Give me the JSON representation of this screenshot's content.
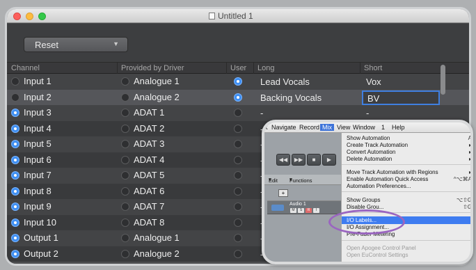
{
  "window": {
    "title": "Untitled 1"
  },
  "toolbar": {
    "reset_label": "Reset"
  },
  "table": {
    "headers": [
      "Channel",
      "Provided by Driver",
      "User",
      "Long",
      "Short"
    ],
    "rows": [
      {
        "channel": "Input 1",
        "channel_on": false,
        "driver": "Analogue 1",
        "user_on": true,
        "long": "Lead Vocals",
        "short": "Vox"
      },
      {
        "channel": "Input 2",
        "channel_on": false,
        "driver": "Analogue 2",
        "user_on": true,
        "long": "Backing Vocals",
        "short": "BV"
      },
      {
        "channel": "Input 3",
        "channel_on": true,
        "driver": "ADAT 1",
        "user_on": false,
        "long": "-",
        "short": "-"
      },
      {
        "channel": "Input 4",
        "channel_on": true,
        "driver": "ADAT 2",
        "user_on": false,
        "long": "-",
        "short": ""
      },
      {
        "channel": "Input 5",
        "channel_on": true,
        "driver": "ADAT 3",
        "user_on": false,
        "long": "-",
        "short": ""
      },
      {
        "channel": "Input 6",
        "channel_on": true,
        "driver": "ADAT 4",
        "user_on": false,
        "long": "-",
        "short": ""
      },
      {
        "channel": "Input 7",
        "channel_on": true,
        "driver": "ADAT 5",
        "user_on": false,
        "long": "-",
        "short": ""
      },
      {
        "channel": "Input 8",
        "channel_on": true,
        "driver": "ADAT 6",
        "user_on": false,
        "long": "-",
        "short": ""
      },
      {
        "channel": "Input 9",
        "channel_on": true,
        "driver": "ADAT 7",
        "user_on": false,
        "long": "-",
        "short": ""
      },
      {
        "channel": "Input 10",
        "channel_on": true,
        "driver": "ADAT 8",
        "user_on": false,
        "long": "-",
        "short": ""
      },
      {
        "channel": "Output 1",
        "channel_on": true,
        "driver": "Analogue 1",
        "user_on": false,
        "long": "-",
        "short": ""
      },
      {
        "channel": "Output 2",
        "channel_on": true,
        "driver": "Analogue 2",
        "user_on": false,
        "long": "-",
        "short": ""
      }
    ]
  },
  "inset": {
    "menubar": [
      "k",
      "Navigate",
      "Record",
      "Mix",
      "View",
      "Window",
      "1",
      "Help"
    ],
    "active_menu": "Mix",
    "transport_icons": [
      "rewind-icon",
      "fast-forward-icon",
      "stop-icon",
      "play-icon"
    ],
    "transport_glyphs": [
      "◀◀",
      "▶▶",
      "■",
      "▶"
    ],
    "edit_toolbar": [
      "Edit",
      "Functions"
    ],
    "plus_label": "+",
    "track_name": "Audio 1",
    "track_buttons": [
      "M",
      "S",
      "R",
      "I"
    ],
    "menu_items": [
      {
        "label": "Show Automation",
        "shortcut": "A",
        "state": "normal"
      },
      {
        "label": "Create Track Automation",
        "shortcut": "▸",
        "state": "normal"
      },
      {
        "label": "Convert Automation",
        "shortcut": "▸",
        "state": "normal"
      },
      {
        "label": "Delete Automation",
        "shortcut": "▸",
        "state": "normal"
      },
      {
        "label": "Move Track Automation with Regions",
        "shortcut": "▸",
        "state": "normal"
      },
      {
        "label": "Enable Automation Quick Access",
        "shortcut": "^⌥⌘A",
        "state": "normal"
      },
      {
        "label": "Automation Preferences...",
        "shortcut": "",
        "state": "normal"
      },
      {
        "label": "Show Groups",
        "shortcut": "⌥⇧G",
        "state": "normal"
      },
      {
        "label": "Disable Grou...",
        "shortcut": "⇧G",
        "state": "normal"
      },
      {
        "label": "I/O Labels...",
        "shortcut": "",
        "state": "highlighted"
      },
      {
        "label": "I/O Assignment...",
        "shortcut": "",
        "state": "normal"
      },
      {
        "label": "Pre-Fader Metering",
        "shortcut": "",
        "state": "normal"
      },
      {
        "label": "Open Apogee Control Panel",
        "shortcut": "",
        "state": "disabled"
      },
      {
        "label": "Open EuControl Settings",
        "shortcut": "",
        "state": "disabled"
      }
    ]
  },
  "colors": {
    "accent": "#3f8ff2",
    "highlight_ring": "#9a65c0",
    "menu_highlight": "#3e7cf0"
  }
}
